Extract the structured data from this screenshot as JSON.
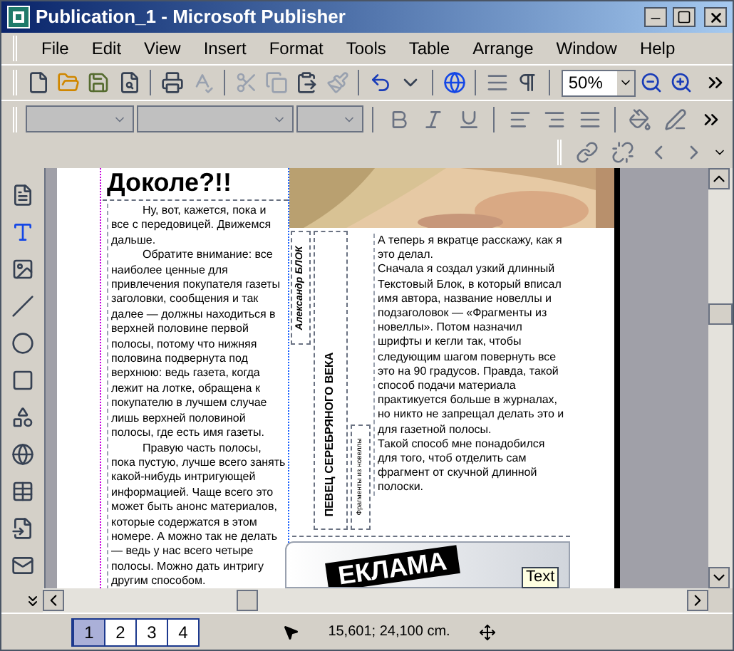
{
  "window": {
    "title": "Publication_1 - Microsoft Publisher"
  },
  "menu": [
    "File",
    "Edit",
    "View",
    "Insert",
    "Format",
    "Tools",
    "Table",
    "Arrange",
    "Window",
    "Help"
  ],
  "zoom": {
    "value": "50%"
  },
  "page": {
    "headline": "Доколе?!!",
    "left_column": [
      "Ну, вот, кажется, пока и все с передовицей. Движемся дальше.",
      "Обратите внимание: все наиболее ценные для привлечения покупателя газеты заголовки, сообщения и так далее — должны находиться в верхней половине первой полосы, потому что нижняя половина подвернута под верхнюю: ведь газета, когда лежит на лотке, обращена к покупателю в лучшем случае лишь верхней половиной полосы, где есть имя газеты.",
      "Правую часть полосы, пока пустую, лучше всего занять какой-нибудь интригующей информацией. Чаще всего это может быть анонс материалов, которые содержатся в этом номере. А можно так не делать — ведь у нас всего четыре полосы. Можно дать интригу другим способом."
    ],
    "author": "Александр БЛОК",
    "story_title": "ПЕВЕЦ СЕРЕБРЯНОГО ВЕКА",
    "subtitle": "Фрагменты из новеллы",
    "right_column": [
      "А теперь я вкратце расскажу, как я это делал.",
      "Сначала я создал узкий длинный Текстовый Блок, в который вписал имя автора, название новеллы и подзаголовок — «Фрагменты из новеллы». Потом назначил шрифты и кегли так, чтобы следующим шагом повернуть все это на 90 градусов. Правда, такой способ подачи материала практикуется больше в журналах, но никто не запрещал делать это и для газетной полосы.",
      "Такой способ мне понадобился для того, чтоб отделить сам фрагмент от скучной длинной полоски."
    ],
    "banner": "ЕКЛАМА",
    "tooltip": "Text"
  },
  "page_tabs": [
    {
      "label": "1",
      "selected": true
    },
    {
      "label": "2",
      "selected": false
    },
    {
      "label": "3",
      "selected": false
    },
    {
      "label": "4",
      "selected": false
    }
  ],
  "status_bar": {
    "position": "15,601; 24,100 cm."
  }
}
